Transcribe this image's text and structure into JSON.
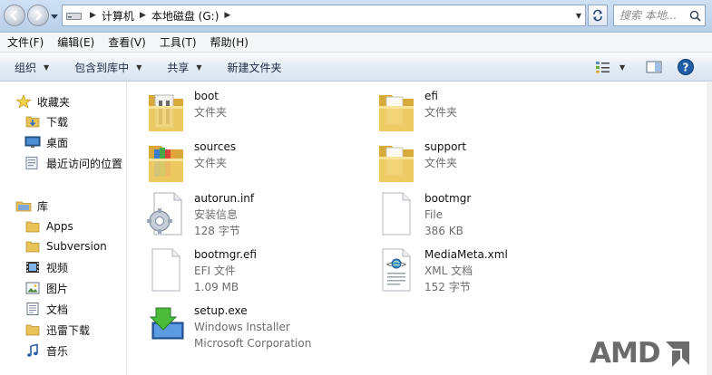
{
  "address": {
    "breadcrumbs": [
      "计算机",
      "本地磁盘 (G:)"
    ],
    "search_placeholder": "搜索 本地..."
  },
  "menu": [
    "文件(F)",
    "编辑(E)",
    "查看(V)",
    "工具(T)",
    "帮助(H)"
  ],
  "toolbar": {
    "organize": "组织",
    "include_library": "包含到库中",
    "share": "共享",
    "new_folder": "新建文件夹"
  },
  "sidebar": {
    "favorites": {
      "label": "收藏夹",
      "items": [
        "下载",
        "桌面",
        "最近访问的位置"
      ]
    },
    "libraries": {
      "label": "库",
      "items": [
        "Apps",
        "Subversion",
        "视频",
        "图片",
        "文档",
        "迅雷下载",
        "音乐"
      ]
    }
  },
  "files": [
    {
      "name": "boot",
      "line2": "文件夹",
      "line3": "",
      "icon": "folder-icon"
    },
    {
      "name": "efi",
      "line2": "文件夹",
      "line3": "",
      "icon": "folder-icon"
    },
    {
      "name": "sources",
      "line2": "文件夹",
      "line3": "",
      "icon": "folder-icon"
    },
    {
      "name": "support",
      "line2": "文件夹",
      "line3": "",
      "icon": "folder-icon"
    },
    {
      "name": "autorun.inf",
      "line2": "安装信息",
      "line3": "128 字节",
      "icon": "settings-file-icon"
    },
    {
      "name": "bootmgr",
      "line2": "File",
      "line3": "386 KB",
      "icon": "blank-file-icon"
    },
    {
      "name": "bootmgr.efi",
      "line2": "EFI 文件",
      "line3": "1.09 MB",
      "icon": "blank-file-icon"
    },
    {
      "name": "MediaMeta.xml",
      "line2": "XML 文档",
      "line3": "152 字节",
      "icon": "xml-file-icon"
    },
    {
      "name": "setup.exe",
      "line2": "Windows Installer",
      "line3": "Microsoft Corporation",
      "icon": "installer-icon"
    }
  ],
  "watermark": "AMD",
  "colors": {
    "address_bg": "#c6d9ef",
    "folder": "#e8c25a",
    "amd_gray": "#6b6b6b"
  }
}
